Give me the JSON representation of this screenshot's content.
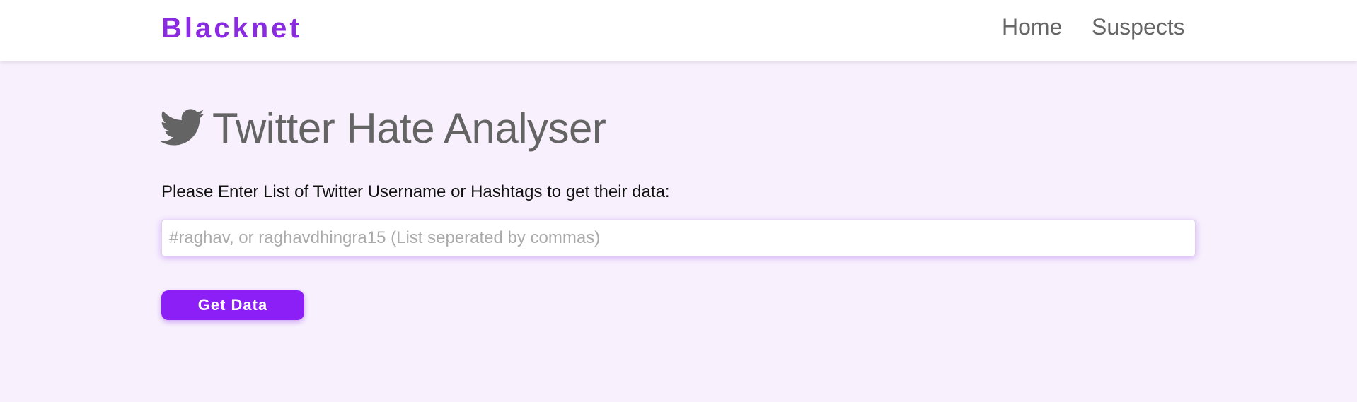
{
  "navbar": {
    "brand": "Blacknet",
    "links": [
      {
        "label": "Home"
      },
      {
        "label": "Suspects"
      }
    ]
  },
  "main": {
    "title_icon": "twitter-bird-icon",
    "title": "Twitter Hate Analyser",
    "prompt": "Please Enter List of Twitter Username or Hashtags to get their data:",
    "input": {
      "value": "",
      "placeholder": "#raghav, or raghavdhingra15 (List seperated by commas)"
    },
    "button_label": "Get Data"
  },
  "colors": {
    "accent": "#8a2be2",
    "button": "#8b1ff5",
    "background": "#f8f1fd",
    "title_text": "#646464"
  }
}
